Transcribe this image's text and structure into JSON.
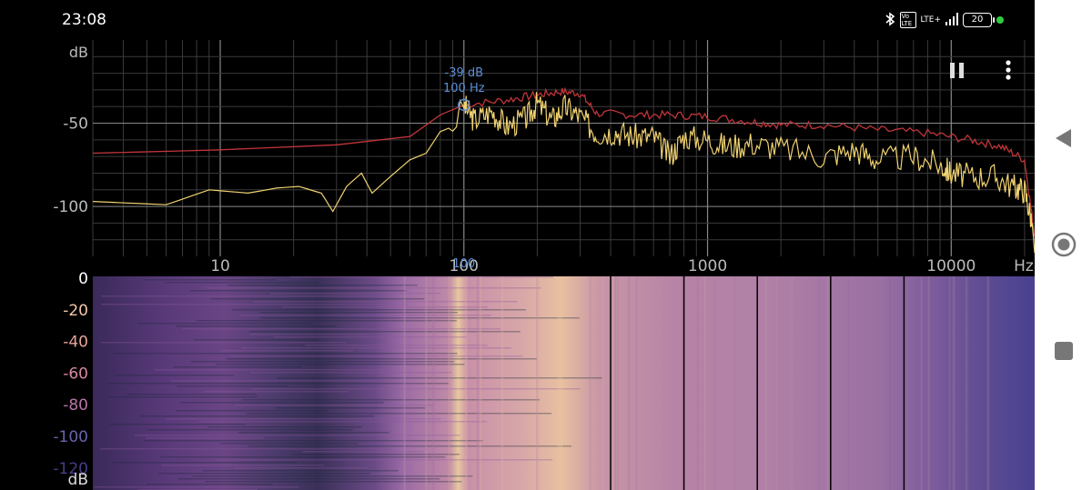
{
  "status": {
    "time": "23:08",
    "battery": "20",
    "network": "LTE+",
    "volte": "Vo LTE",
    "bluetooth_icon": "bluetooth-icon",
    "dot_color": "#2ecc40"
  },
  "controls": {
    "pause_icon": "pause-icon",
    "menu_icon": "more-vert-icon"
  },
  "spectrum": {
    "ylabel": "dB",
    "xunit": "Hz",
    "yticks": [
      -50,
      -100
    ],
    "xticks": [
      10,
      100,
      1000,
      10000
    ],
    "xrange": [
      3,
      22000
    ],
    "yrange": [
      -130,
      0
    ],
    "peak": {
      "db_label": "-39 dB",
      "hz_label": "100 Hz",
      "freq": 100,
      "db": -39
    },
    "cursor_label": "100",
    "colors": {
      "max_trace": "#c0353a",
      "current_trace": "#f0d270",
      "grid": "#555555",
      "peak": "#5b8fd6"
    },
    "max_trace": [
      [
        3,
        -68
      ],
      [
        10,
        -66
      ],
      [
        30,
        -63
      ],
      [
        60,
        -58
      ],
      [
        80,
        -45
      ],
      [
        100,
        -39
      ],
      [
        150,
        -36
      ],
      [
        200,
        -33
      ],
      [
        250,
        -31
      ],
      [
        300,
        -32
      ],
      [
        350,
        -44
      ],
      [
        500,
        -45
      ],
      [
        700,
        -45
      ],
      [
        1000,
        -46
      ],
      [
        1500,
        -49
      ],
      [
        2000,
        -51
      ],
      [
        3000,
        -51
      ],
      [
        5000,
        -54
      ],
      [
        8000,
        -56
      ],
      [
        12000,
        -60
      ],
      [
        16000,
        -64
      ],
      [
        20000,
        -72
      ],
      [
        22000,
        -118
      ]
    ],
    "current_trace": [
      [
        3,
        -97
      ],
      [
        6,
        -99
      ],
      [
        9,
        -90
      ],
      [
        13,
        -92
      ],
      [
        17,
        -89
      ],
      [
        21,
        -88
      ],
      [
        26,
        -92
      ],
      [
        29,
        -103
      ],
      [
        33,
        -88
      ],
      [
        38,
        -80
      ],
      [
        42,
        -92
      ],
      [
        50,
        -82
      ],
      [
        60,
        -72
      ],
      [
        70,
        -68
      ],
      [
        80,
        -55
      ],
      [
        90,
        -52
      ],
      [
        100,
        -39
      ],
      [
        110,
        -48
      ],
      [
        130,
        -43
      ],
      [
        150,
        -52
      ],
      [
        180,
        -47
      ],
      [
        200,
        -38
      ],
      [
        230,
        -48
      ],
      [
        260,
        -40
      ],
      [
        300,
        -46
      ],
      [
        350,
        -56
      ],
      [
        420,
        -55
      ],
      [
        500,
        -58
      ],
      [
        600,
        -58
      ],
      [
        700,
        -70
      ],
      [
        800,
        -58
      ],
      [
        1000,
        -60
      ],
      [
        1200,
        -64
      ],
      [
        1500,
        -62
      ],
      [
        2000,
        -65
      ],
      [
        3000,
        -70
      ],
      [
        4000,
        -66
      ],
      [
        5000,
        -72
      ],
      [
        7000,
        -70
      ],
      [
        9000,
        -75
      ],
      [
        10000,
        -80
      ],
      [
        12000,
        -82
      ],
      [
        15000,
        -82
      ],
      [
        18000,
        -88
      ],
      [
        20000,
        -90
      ],
      [
        21500,
        -110
      ],
      [
        22000,
        -128
      ]
    ]
  },
  "spectrogram": {
    "ylabel": "dB",
    "yticks": [
      0,
      -20,
      -40,
      -60,
      -80,
      -100,
      -120
    ],
    "marker_freqs": [
      400,
      800,
      1600,
      3200,
      6400
    ]
  },
  "nav": {
    "back_icon": "back-triangle-icon",
    "home_icon": "home-circle-icon",
    "recents_icon": "recents-square-icon"
  }
}
